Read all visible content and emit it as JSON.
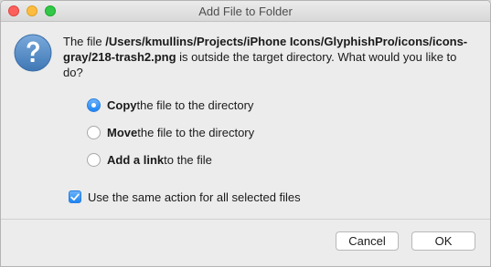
{
  "window": {
    "title": "Add File to Folder"
  },
  "icon": "question-mark-icon",
  "message": {
    "prefix": "The file ",
    "path": "/Users/kmullins/Projects/iPhone Icons/GlyphishPro/icons/icons-gray/218-trash2.png",
    "suffix": " is outside the target directory. What would you like to do?"
  },
  "options": [
    {
      "bold": "Copy",
      "rest": " the file to the directory",
      "selected": true
    },
    {
      "bold": "Move",
      "rest": " the file to the directory",
      "selected": false
    },
    {
      "bold": "Add a link",
      "rest": " to the file",
      "selected": false
    }
  ],
  "same_action": {
    "label": "Use the same action for all selected files",
    "checked": true
  },
  "buttons": {
    "cancel": "Cancel",
    "ok": "OK"
  },
  "colors": {
    "accent": "#1d84f4",
    "icon": "#5a8fc6"
  }
}
